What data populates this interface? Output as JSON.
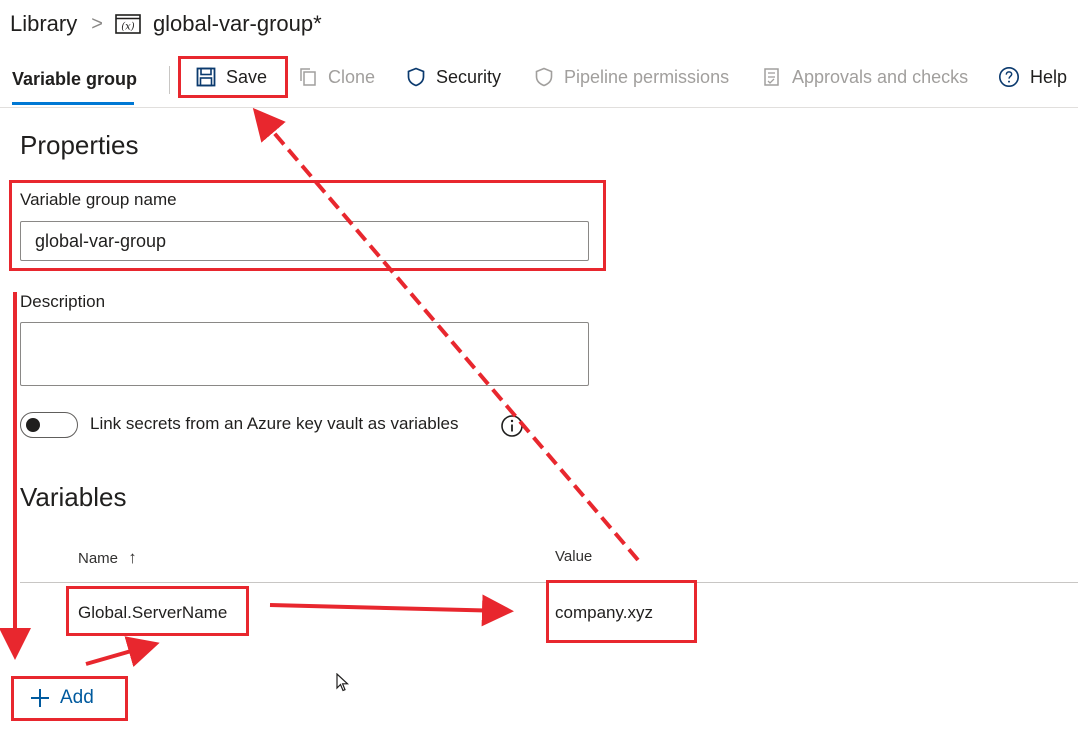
{
  "breadcrumb": {
    "root": "Library",
    "separator": ">",
    "title": "global-var-group*",
    "icon": "variable-group-icon"
  },
  "toolbar": {
    "tab_label": "Variable group",
    "save_label": "Save",
    "clone_label": "Clone",
    "security_label": "Security",
    "pipeline_permissions_label": "Pipeline permissions",
    "approvals_label": "Approvals and checks",
    "help_label": "Help"
  },
  "properties": {
    "heading": "Properties",
    "name_label": "Variable group name",
    "name_value": "global-var-group",
    "description_label": "Description",
    "description_value": "",
    "keyvault_toggle_label": "Link secrets from an Azure key vault as variables",
    "keyvault_toggle_on": false
  },
  "variables": {
    "heading": "Variables",
    "columns": {
      "name": "Name",
      "name_sort": "↑",
      "value": "Value"
    },
    "rows": [
      {
        "name": "Global.ServerName",
        "value": "company.xyz"
      }
    ],
    "add_label": "Add"
  },
  "colors": {
    "accent": "#0078d4",
    "annotation_red": "#e8272e",
    "disabled_text": "#a19f9d"
  }
}
